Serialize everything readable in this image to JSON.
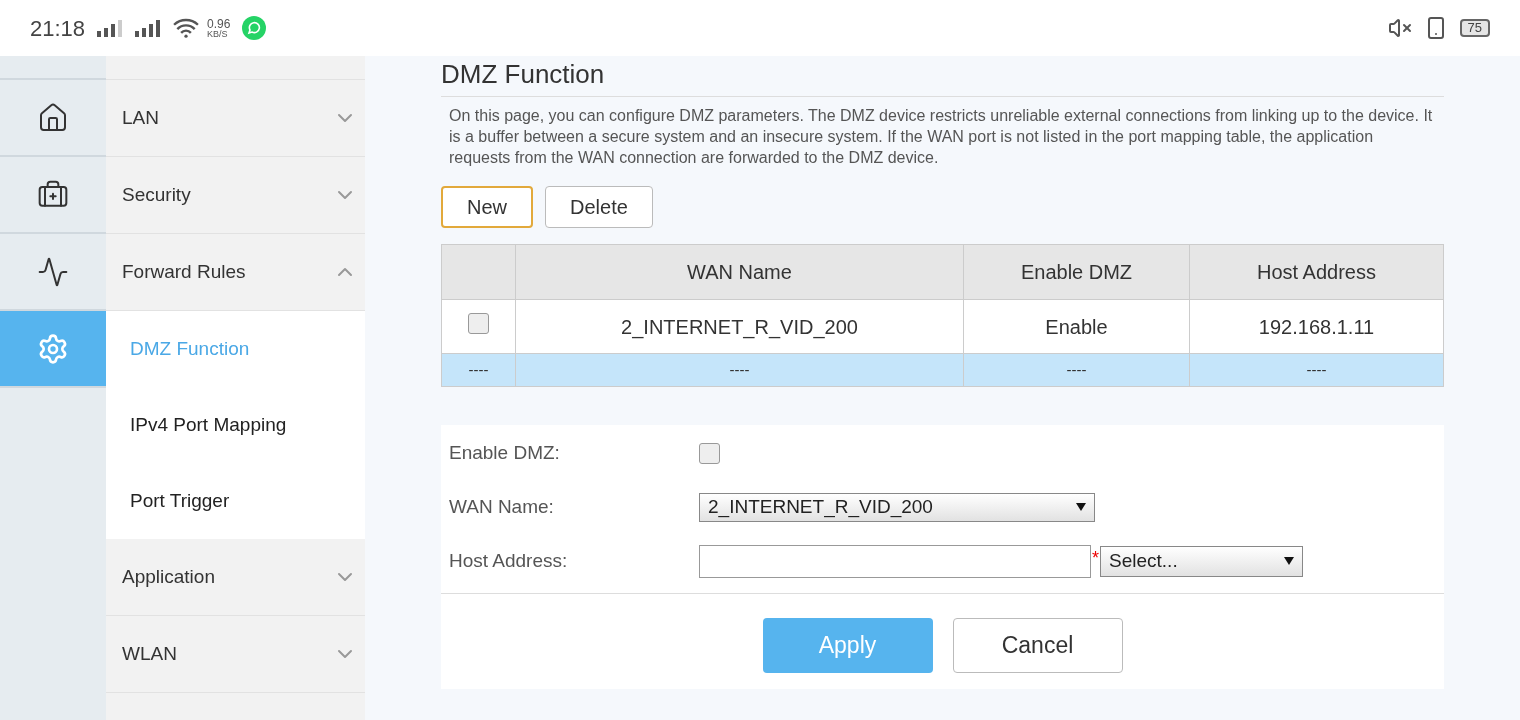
{
  "status_bar": {
    "time": "21:18",
    "speed": "0.96",
    "speed_unit": "KB/S",
    "battery": "75"
  },
  "rail": [
    {
      "kind": "home",
      "selected": false
    },
    {
      "kind": "kit",
      "selected": false
    },
    {
      "kind": "pulse",
      "selected": false
    },
    {
      "kind": "gear",
      "selected": true
    }
  ],
  "menu": [
    {
      "label": "LAN",
      "expanded": false
    },
    {
      "label": "Security",
      "expanded": false
    },
    {
      "label": "Forward Rules",
      "expanded": true,
      "children": [
        {
          "label": "DMZ Function",
          "selected": true
        },
        {
          "label": "IPv4 Port Mapping",
          "selected": false
        },
        {
          "label": "Port Trigger",
          "selected": false
        }
      ]
    },
    {
      "label": "Application",
      "expanded": false
    },
    {
      "label": "WLAN",
      "expanded": false
    }
  ],
  "page": {
    "title": "DMZ Function",
    "description": "On this page, you can configure DMZ parameters. The DMZ device restricts unreliable external connections from linking up to the device. It is a buffer between a secure system and an insecure system. If the WAN port is not listed in the port mapping table, the application requests from the WAN connection are forwarded to the DMZ device."
  },
  "toolbar": [
    {
      "label": "New",
      "focused": true
    },
    {
      "label": "Delete",
      "focused": false
    }
  ],
  "table": {
    "columns": [
      "WAN Name",
      "Enable DMZ",
      "Host Address"
    ],
    "rows": [
      {
        "kind": "data",
        "checked": false,
        "cells": [
          "2_INTERNET_R_VID_200",
          "Enable",
          "192.168.1.11"
        ]
      },
      {
        "kind": "placeholder",
        "marker": "----",
        "cells": [
          "----",
          "----",
          "----"
        ]
      }
    ]
  },
  "form": {
    "enable_dmz": {
      "label": "Enable DMZ:",
      "checked": false
    },
    "wan_name": {
      "label": "WAN Name:",
      "value": "2_INTERNET_R_VID_200"
    },
    "host_address": {
      "label": "Host Address:",
      "required_mark": "*",
      "select": "Select..."
    }
  },
  "buttons": [
    {
      "label": "Apply",
      "kind": "primary"
    },
    {
      "label": "Cancel",
      "kind": "secondary"
    }
  ]
}
